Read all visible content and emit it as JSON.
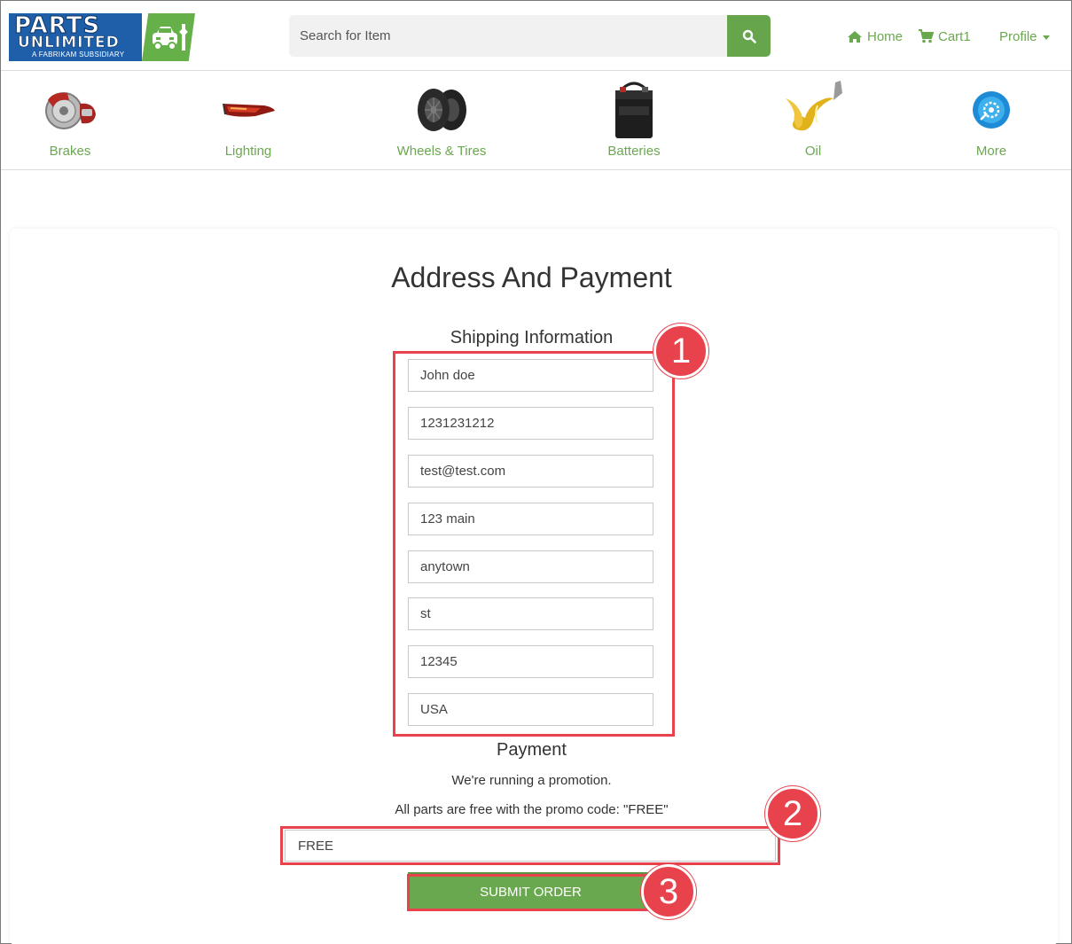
{
  "header": {
    "logo": {
      "line1": "PARTS",
      "line2": "UNLIMITED",
      "line3": "A FABRIKAM SUBSIDIARY"
    },
    "search": {
      "placeholder": "Search for Item"
    },
    "nav": {
      "home": "Home",
      "cart": "Cart1",
      "profile": "Profile"
    }
  },
  "categories": [
    {
      "label": "Brakes",
      "icon": "brakes-icon"
    },
    {
      "label": "Lighting",
      "icon": "lighting-icon"
    },
    {
      "label": "Wheels & Tires",
      "icon": "wheels-icon"
    },
    {
      "label": "Batteries",
      "icon": "battery-icon"
    },
    {
      "label": "Oil",
      "icon": "oil-icon"
    },
    {
      "label": "More",
      "icon": "more-icon"
    }
  ],
  "main": {
    "title": "Address And Payment",
    "shipping": {
      "heading": "Shipping Information",
      "fields": [
        "John doe",
        "1231231212",
        "test@test.com",
        "123 main",
        "anytown",
        "st",
        "12345",
        "USA"
      ]
    },
    "payment": {
      "heading": "Payment",
      "promo_line1": "We're running a promotion.",
      "promo_line2": "All parts are free with the promo code: \"FREE\"",
      "promo_value": "FREE",
      "submit": "SUBMIT ORDER"
    }
  },
  "annotations": {
    "c1": "1",
    "c2": "2",
    "c3": "3"
  },
  "colors": {
    "accent_green": "#6aa84f",
    "brand_blue": "#1f5faa",
    "annotation_red": "#e8434d"
  }
}
